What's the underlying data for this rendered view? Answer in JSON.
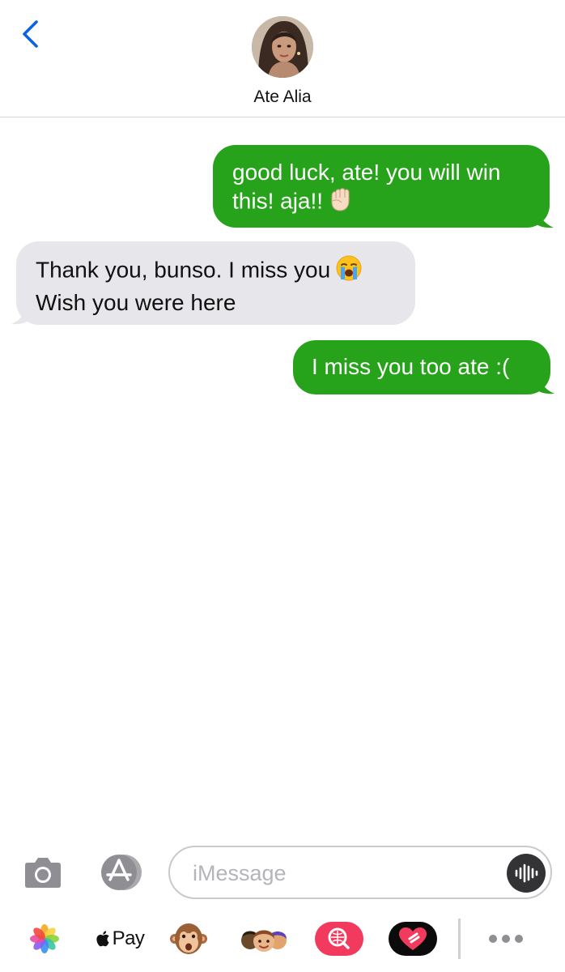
{
  "header": {
    "back_label": "Back",
    "contact_name": "Ate Alia"
  },
  "messages": [
    {
      "direction": "outgoing",
      "text": "good luck, ate! you will win\nthis! aja!!",
      "emoji": "raised-fist-emoji"
    },
    {
      "direction": "incoming",
      "line1": "Thank you, bunso. I miss you",
      "line2": "Wish you were here",
      "emoji": "loudly-crying-face-emoji"
    },
    {
      "direction": "outgoing",
      "text": "I miss you too ate :("
    }
  ],
  "input": {
    "placeholder": "iMessage",
    "value": ""
  },
  "drawer": {
    "apple_pay_label": "Pay",
    "apps": [
      "photos-icon",
      "apple-pay-icon",
      "animoji-monkey-icon",
      "memoji-stickers-icon",
      "images-search-icon",
      "digital-touch-icon",
      "more-icon"
    ]
  },
  "colors": {
    "outgoing_bubble": "#26a31a",
    "incoming_bubble": "#e6e6eb",
    "accent_blue": "#0a63e6"
  }
}
